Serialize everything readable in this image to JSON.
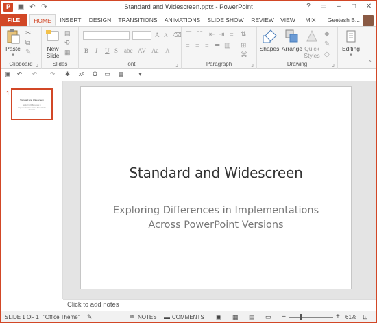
{
  "window": {
    "title": "Standard and Widescreen.pptx - PowerPoint",
    "app_icon_letter": "P"
  },
  "tabs": [
    {
      "label": "FILE"
    },
    {
      "label": "HOME"
    },
    {
      "label": "INSERT"
    },
    {
      "label": "DESIGN"
    },
    {
      "label": "TRANSITIONS"
    },
    {
      "label": "ANIMATIONS"
    },
    {
      "label": "SLIDE SHOW"
    },
    {
      "label": "REVIEW"
    },
    {
      "label": "VIEW"
    },
    {
      "label": "MIX"
    }
  ],
  "active_tab": "HOME",
  "user": {
    "name": "Geetesh B..."
  },
  "ribbon": {
    "clipboard": {
      "group_label": "Clipboard",
      "paste_label": "Paste"
    },
    "slides": {
      "group_label": "Slides",
      "new_slide_label_1": "New",
      "new_slide_label_2": "Slide"
    },
    "font": {
      "group_label": "Font"
    },
    "paragraph": {
      "group_label": "Paragraph"
    },
    "drawing": {
      "group_label": "Drawing",
      "shapes_label": "Shapes",
      "arrange_label": "Arrange",
      "quick_styles_label_1": "Quick",
      "quick_styles_label_2": "Styles"
    },
    "editing": {
      "label": "Editing"
    }
  },
  "thumbnails": [
    {
      "number": "1",
      "title": "Standard and Widescreen",
      "subtitle": "Exploring Differences in Implementations Across PowerPoint Versions"
    }
  ],
  "slide": {
    "title": "Standard and Widescreen",
    "subtitle": "Exploring Differences in Implementations Across PowerPoint Versions"
  },
  "notes_placeholder": "Click to add notes",
  "status": {
    "slide_info": "SLIDE 1 OF 1",
    "theme": "\"Office Theme\"",
    "notes_label": "NOTES",
    "comments_label": "COMMENTS",
    "zoom_label": "61%",
    "zoom_level_percent": 61
  },
  "colors": {
    "accent": "#d24726",
    "ribbon_bg": "#f5f5f5"
  }
}
